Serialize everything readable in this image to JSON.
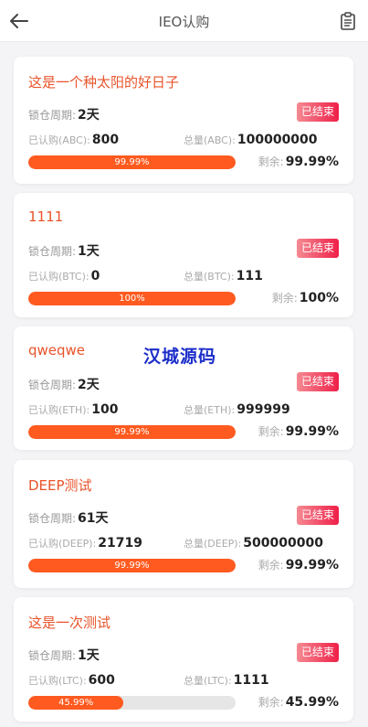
{
  "header": {
    "title": "IEO认购",
    "back_icon": "back-arrow-icon",
    "doc_icon": "clipboard-icon"
  },
  "labels": {
    "lock_period": "锁仓周期:",
    "remain": "剩余:"
  },
  "watermark": "汉城源码",
  "colors": {
    "accent": "#e8532a",
    "progress": "#ff5a1f",
    "badge_from": "#f58a92",
    "badge_to": "#ef1f48"
  },
  "projects": [
    {
      "title": "这是一个种太阳的好日子",
      "lock": "2天",
      "status": "已结束",
      "subscribed_label": "已认购(ABC):",
      "subscribed": "800",
      "total_label": "总量(ABC):",
      "total": "100000000",
      "progress_text": "99.99%",
      "progress": 99.99,
      "remain": "99.99%"
    },
    {
      "title": "1111",
      "lock": "1天",
      "status": "已结束",
      "subscribed_label": "已认购(BTC):",
      "subscribed": "0",
      "total_label": "总量(BTC):",
      "total": "111",
      "progress_text": "100%",
      "progress": 100,
      "remain": "100%"
    },
    {
      "title": "qweqwe",
      "lock": "2天",
      "status": "已结束",
      "subscribed_label": "已认购(ETH):",
      "subscribed": "100",
      "total_label": "总量(ETH):",
      "total": "999999",
      "progress_text": "99.99%",
      "progress": 99.99,
      "remain": "99.99%"
    },
    {
      "title": "DEEP测试",
      "lock": "61天",
      "status": "已结束",
      "subscribed_label": "已认购(DEEP):",
      "subscribed": "21719",
      "total_label": "总量(DEEP):",
      "total": "500000000",
      "progress_text": "99.99%",
      "progress": 99.99,
      "remain": "99.99%"
    },
    {
      "title": "这是一次测试",
      "lock": "1天",
      "status": "已结束",
      "subscribed_label": "已认购(LTC):",
      "subscribed": "600",
      "total_label": "总量(LTC):",
      "total": "1111",
      "progress_text": "45.99%",
      "progress": 45.99,
      "remain": "45.99%"
    }
  ]
}
